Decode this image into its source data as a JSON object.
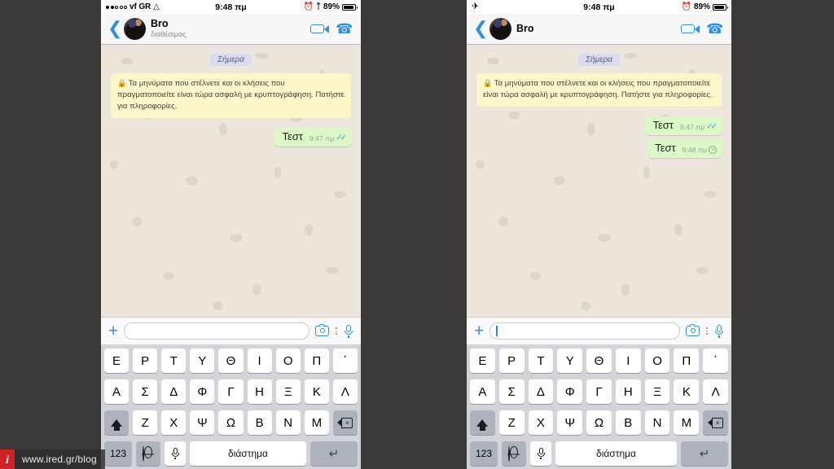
{
  "watermark": {
    "logo_letter": "i",
    "url": "www.ired.gr/blog"
  },
  "panels": [
    {
      "id": "left",
      "statusbar": {
        "signal_dots_filled": 2,
        "signal_dots_total": 5,
        "carrier": "vf GR",
        "wifi_icon": "wifi-icon",
        "time": "9:48 πμ",
        "alarm_icon": "alarm-icon",
        "bluetooth_icon": "bluetooth-icon",
        "battery_percent": "89%",
        "battery_level": 89,
        "airplane_mode": false
      },
      "navbar": {
        "back_icon": "back-chevron-icon",
        "contact_name": "Bro",
        "contact_status": "διαθέσιμος",
        "video_call_icon": "video-call-icon",
        "voice_call_icon": "voice-call-icon"
      },
      "chat": {
        "day_divider": "Σήμερα",
        "system_message": "Τα μηνύματα που στέλνετε και οι κλήσεις που πραγματοποιείτε είναι τώρα ασφαλή με κρυπτογράφηση. Πατήστε για πληροφορίες.",
        "system_lock_icon": "lock-icon",
        "messages": [
          {
            "text": "Τεστ",
            "time": "9:47 πμ",
            "status": "read",
            "status_icon": "double-check-icon"
          }
        ]
      },
      "inputbar": {
        "plus_icon": "plus-icon",
        "field_value": "",
        "field_focused": false,
        "camera_icon": "camera-icon",
        "more_icon": "kebab-menu-icon",
        "mic_icon": "microphone-icon"
      }
    },
    {
      "id": "right",
      "statusbar": {
        "signal_dots_filled": 0,
        "signal_dots_total": 0,
        "carrier": "",
        "wifi_icon": "",
        "time": "9:48 πμ",
        "alarm_icon": "alarm-icon",
        "bluetooth_icon": "",
        "battery_percent": "89%",
        "battery_level": 89,
        "airplane_mode": true,
        "airplane_icon": "airplane-mode-icon"
      },
      "navbar": {
        "back_icon": "back-chevron-icon",
        "contact_name": "Bro",
        "contact_status": "",
        "video_call_icon": "video-call-icon",
        "voice_call_icon": "voice-call-icon"
      },
      "chat": {
        "day_divider": "Σήμερα",
        "system_message": "Τα μηνύματα που στέλνετε και οι κλήσεις που πραγματοποιείτε είναι τώρα ασφαλή με κρυπτογράφηση. Πατήστε για πληροφορίες.",
        "system_lock_icon": "lock-icon",
        "messages": [
          {
            "text": "Τεστ",
            "time": "9:47 πμ",
            "status": "read",
            "status_icon": "double-check-icon"
          },
          {
            "text": "Τεστ",
            "time": "9:48 πμ",
            "status": "pending",
            "status_icon": "clock-icon"
          }
        ]
      },
      "inputbar": {
        "plus_icon": "plus-icon",
        "field_value": "",
        "field_focused": true,
        "camera_icon": "camera-icon",
        "more_icon": "kebab-menu-icon",
        "mic_icon": "microphone-icon"
      }
    }
  ],
  "keyboard": {
    "row1": [
      "Ε",
      "Ρ",
      "Τ",
      "Υ",
      "Θ",
      "Ι",
      "Ο",
      "Π",
      "΄"
    ],
    "row2": [
      "Α",
      "Σ",
      "Δ",
      "Φ",
      "Γ",
      "Η",
      "Ξ",
      "Κ",
      "Λ"
    ],
    "row3": [
      "Ζ",
      "Χ",
      "Ψ",
      "Ω",
      "Β",
      "Ν",
      "Μ"
    ],
    "shift_icon": "shift-icon",
    "backspace_icon": "backspace-icon",
    "numbers_key": "123",
    "globe_icon": "globe-icon",
    "mic_icon": "microphone-icon",
    "space_key": "διάστημα",
    "return_icon": "return-icon"
  },
  "colors": {
    "accent_blue": "#2e8fe0",
    "bubble_out": "#dcf8c6",
    "system_bubble": "#fdf6c8",
    "day_pill": "#d8dcf0",
    "chat_bg": "#ece6dd",
    "keyboard_bg": "#d2d4da",
    "backdrop": "#3c3a39",
    "watermark_red": "#cf2128"
  }
}
